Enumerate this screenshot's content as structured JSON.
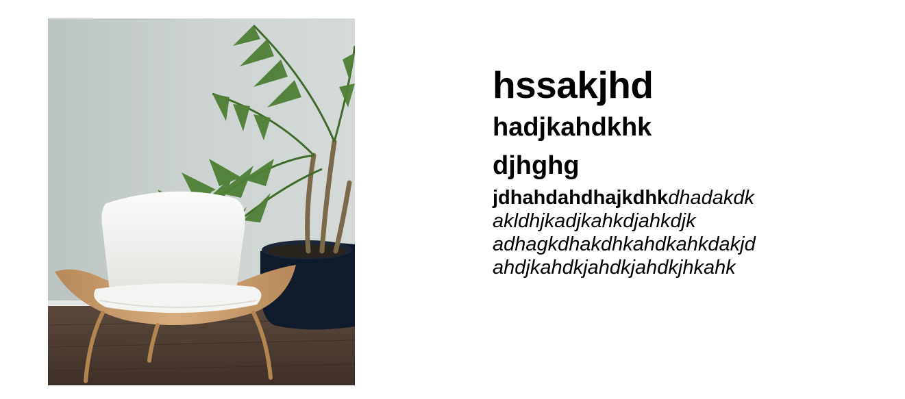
{
  "photo": {
    "alt_subject": "white shell chair next to potted palm"
  },
  "text": {
    "heading1": "hssakjhd",
    "heading2": "hadjkahdkhk",
    "heading3": "djhghg",
    "paragraph": {
      "line1_bold": "jdhahdahdhajkdhk",
      "line1_italic": "dhadakdk",
      "line2": "akldhjkadjkahkdjahkdjk",
      "line3": "adhagkdhakdhkahdkahkdakjd",
      "line4": "ahdjkahdkjahdkjahdkjhkahk"
    }
  },
  "colors": {
    "background": "#ffffff",
    "text": "#000000",
    "wall": "#c9d0ce",
    "floor": "#4a3a30",
    "chair_shell": "#c79c6b",
    "cushion": "#f4f4f2",
    "pot": "#0f1a2a",
    "leaf": "#4f7f35"
  }
}
